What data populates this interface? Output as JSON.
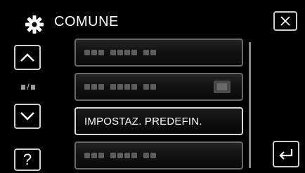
{
  "header": {
    "title": "COMUNE",
    "icon": "gear-icon"
  },
  "controls": {
    "close_icon": "close-icon",
    "up_icon": "chevron-up-icon",
    "down_icon": "chevron-down-icon",
    "help_label": "?",
    "back_icon": "return-icon",
    "page_separator": "/"
  },
  "menu": {
    "items": [
      {
        "label": "",
        "selected": false
      },
      {
        "label": "",
        "selected": false,
        "has_value_chip": true
      },
      {
        "label": "IMPOSTAZ. PREDEFIN.",
        "selected": true
      },
      {
        "label": "",
        "selected": false
      }
    ]
  }
}
